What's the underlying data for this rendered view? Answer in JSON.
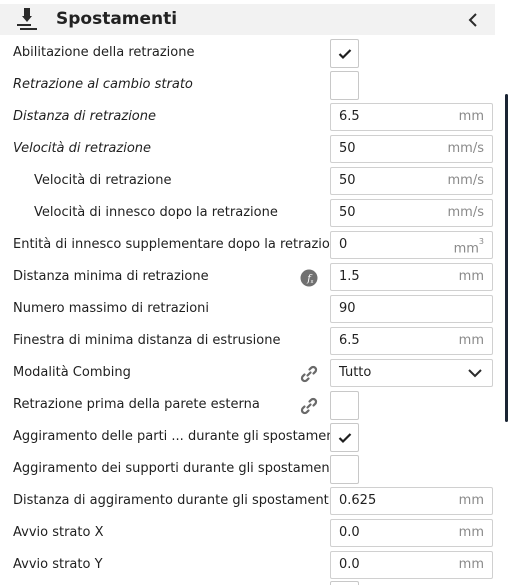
{
  "panel": {
    "title": "Spostamenti"
  },
  "rows": [
    {
      "label": "Abilitazione della retrazione",
      "type": "checkbox",
      "checked": true
    },
    {
      "label": "Retrazione al cambio strato",
      "type": "checkbox",
      "checked": false
    },
    {
      "label": "Distanza di retrazione",
      "type": "input",
      "value": "6.5",
      "unit": "mm"
    },
    {
      "label": "Velocità di retrazione",
      "type": "input",
      "value": "50",
      "unit": "mm/s"
    },
    {
      "label": "Velocità di retrazione",
      "type": "input",
      "value": "50",
      "unit": "mm/s"
    },
    {
      "label": "Velocità di innesco dopo la retrazione",
      "type": "input",
      "value": "50",
      "unit": "mm/s"
    },
    {
      "label": "Entità di innesco supplementare dopo la retrazione",
      "type": "input",
      "value": "0",
      "unit": "mm",
      "unit_sup": "3"
    },
    {
      "label": "Distanza minima di retrazione",
      "type": "input",
      "value": "1.5",
      "unit": "mm",
      "icon": "function-icon"
    },
    {
      "label": "Numero massimo di retrazioni",
      "type": "input",
      "value": "90",
      "unit": ""
    },
    {
      "label": "Finestra di minima distanza di estrusione",
      "type": "input",
      "value": "6.5",
      "unit": "mm"
    },
    {
      "label": "Modalità Combing",
      "type": "dropdown",
      "value": "Tutto",
      "icon": "link-icon"
    },
    {
      "label": "Retrazione prima della parete esterna",
      "type": "checkbox",
      "checked": false,
      "icon": "link-icon"
    },
    {
      "label": "Aggiramento delle parti ... durante gli spostamenti",
      "type": "checkbox",
      "checked": true
    },
    {
      "label": "Aggiramento dei supporti durante gli spostamenti",
      "type": "checkbox",
      "checked": false
    },
    {
      "label": "Distanza di aggiramento durante gli spostamenti",
      "type": "input",
      "value": "0.625",
      "unit": "mm"
    },
    {
      "label": "Avvio strato X",
      "type": "input",
      "value": "0.0",
      "unit": "mm"
    },
    {
      "label": "Avvio strato Y",
      "type": "input",
      "value": "0.0",
      "unit": "mm"
    }
  ]
}
